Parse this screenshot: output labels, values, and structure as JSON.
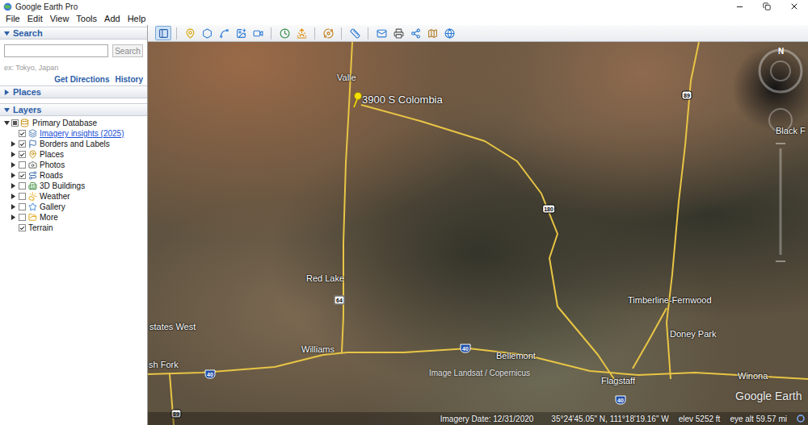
{
  "window": {
    "title": "Google Earth Pro"
  },
  "menu": [
    "File",
    "Edit",
    "View",
    "Tools",
    "Add",
    "Help"
  ],
  "toolbar": [
    {
      "selected": true
    },
    {
      "selected": false
    },
    {
      "selected": false
    },
    {
      "selected": false
    },
    {
      "selected": false
    },
    {
      "selected": false
    },
    {
      "selected": false
    },
    {
      "selected": false
    },
    {
      "selected": false
    },
    {
      "selected": false
    },
    {
      "selected": false
    },
    {
      "selected": false
    },
    {
      "selected": false
    },
    {
      "selected": false
    },
    {
      "selected": false
    }
  ],
  "sidebar": {
    "search": {
      "title": "Search",
      "expanded": true,
      "button": {
        "label": "Search",
        "disabled": true
      },
      "hint": "ex: Tokyo, Japan",
      "links": [
        "Get Directions",
        "History"
      ]
    },
    "places": {
      "title": "Places",
      "expanded": false
    },
    "layers": {
      "title": "Layers",
      "expanded": true,
      "root": {
        "label": "Primary Database",
        "expanded": true,
        "checked": false,
        "partial": true
      },
      "items": [
        {
          "label": "Imagery insights (2025)",
          "expandable": false,
          "expanded": false,
          "checked": true,
          "link": true
        },
        {
          "label": "Borders and Labels",
          "expandable": true,
          "expanded": false,
          "checked": true,
          "link": false
        },
        {
          "label": "Places",
          "expandable": true,
          "expanded": false,
          "checked": true,
          "link": false
        },
        {
          "label": "Photos",
          "expandable": true,
          "expanded": false,
          "checked": false,
          "link": false
        },
        {
          "label": "Roads",
          "expandable": true,
          "expanded": false,
          "checked": true,
          "link": false
        },
        {
          "label": "3D Buildings",
          "expandable": true,
          "expanded": false,
          "checked": false,
          "link": false
        },
        {
          "label": "Weather",
          "expandable": true,
          "expanded": false,
          "checked": false,
          "link": false
        },
        {
          "label": "Gallery",
          "expandable": true,
          "expanded": false,
          "checked": false,
          "link": false
        },
        {
          "label": "More",
          "expandable": true,
          "expanded": false,
          "checked": false,
          "link": false
        },
        {
          "label": "Terrain",
          "expandable": false,
          "expanded": false,
          "checked": true,
          "link": false
        }
      ]
    }
  },
  "map": {
    "placemark": {
      "label": "3900 S Colombia"
    },
    "labels": [
      "Valle",
      "Red Lake",
      "states West",
      "Williams",
      "sh Fork",
      "Bellemont",
      "Flagstaff",
      "Timberline-Fernwood",
      "Doney Park",
      "Winona",
      "Black F"
    ],
    "shields": [
      {
        "number": "89",
        "kind": "us"
      },
      {
        "number": "180",
        "kind": "us"
      },
      {
        "number": "64",
        "kind": "state"
      },
      {
        "number": "40",
        "kind": "interstate"
      },
      {
        "number": "40",
        "kind": "interstate"
      },
      {
        "number": "40",
        "kind": "interstate"
      },
      {
        "number": "89",
        "kind": "us"
      }
    ],
    "attribution": "Image Landsat / Copernicus",
    "watermark": "Google Earth",
    "compass": "N"
  },
  "status_bar": {
    "imagery_date": "Imagery Date: 12/31/2020",
    "coordinates": "35°24'45.05\" N, 111°18'19.16\" W",
    "elevation": "elev 5252 ft",
    "eye_altitude": "eye alt 59.57 mi"
  }
}
